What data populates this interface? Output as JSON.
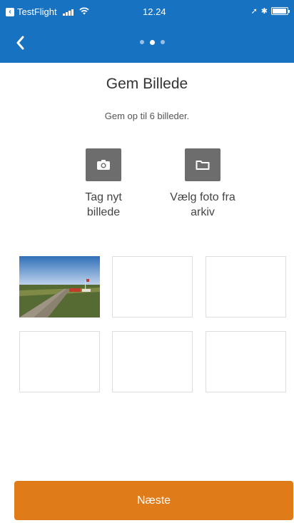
{
  "status_bar": {
    "app_back_label": "TestFlight",
    "time": "12.24"
  },
  "nav": {
    "back_icon": "chevron-left-icon",
    "page_indicator": {
      "count": 3,
      "active_index": 1
    }
  },
  "main": {
    "title": "Gem Billede",
    "subtitle": "Gem op til 6 billeder.",
    "actions": [
      {
        "label_line1": "Tag nyt",
        "label_line2": "billede",
        "icon": "camera-icon"
      },
      {
        "label_line1": "Vælg foto fra",
        "label_line2": "arkiv",
        "icon": "folder-icon"
      }
    ],
    "photo_slots": {
      "total": 6,
      "filled": 1
    }
  },
  "footer": {
    "next_label": "Næste"
  },
  "colors": {
    "primary_blue": "#1872c2",
    "accent_orange": "#e07b1a",
    "icon_gray": "#6d6d6d"
  }
}
